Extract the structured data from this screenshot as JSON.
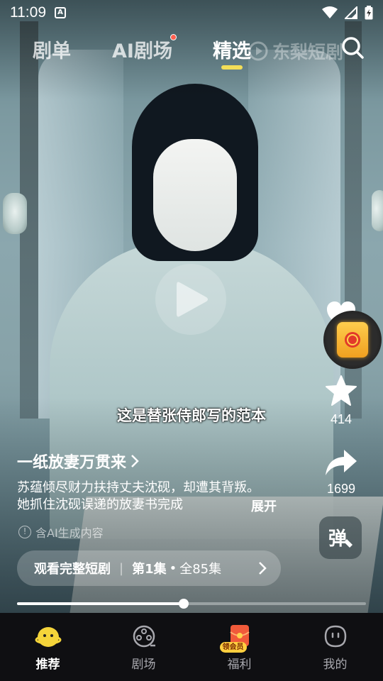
{
  "status_bar": {
    "time": "11:09",
    "badge": "A"
  },
  "top_tabs": [
    {
      "label": "剧单"
    },
    {
      "label": "AI剧场"
    },
    {
      "label": "精选"
    }
  ],
  "watermark": "东梨短剧",
  "subtitle": "这是替张侍郎写的范本",
  "drama": {
    "title": "一纸放妻万贯来",
    "description": "苏蕴倾尽财力扶持丈夫沈砚，却遭其背叛。她抓住沈砚误递的放妻书完成",
    "expand_label": "展开",
    "ai_note": "含AI生成内容"
  },
  "rail": {
    "star_count": "414",
    "share_count": "1699",
    "danmu_label": "弹"
  },
  "watch_bar": {
    "label": "观看完整短剧",
    "episode": "第1集",
    "dot": "•",
    "total": "全85集"
  },
  "progress": {
    "fraction": 0.478
  },
  "bottom_nav": [
    {
      "label": "推荐",
      "active": true
    },
    {
      "label": "剧场",
      "active": false
    },
    {
      "label": "福利",
      "active": false,
      "badge": "领会员"
    },
    {
      "label": "我的",
      "active": false
    }
  ],
  "colors": {
    "tab_underline": "#f3de58",
    "tab_dot": "#ff5f4f",
    "nav_bg": "#0f0f12"
  }
}
